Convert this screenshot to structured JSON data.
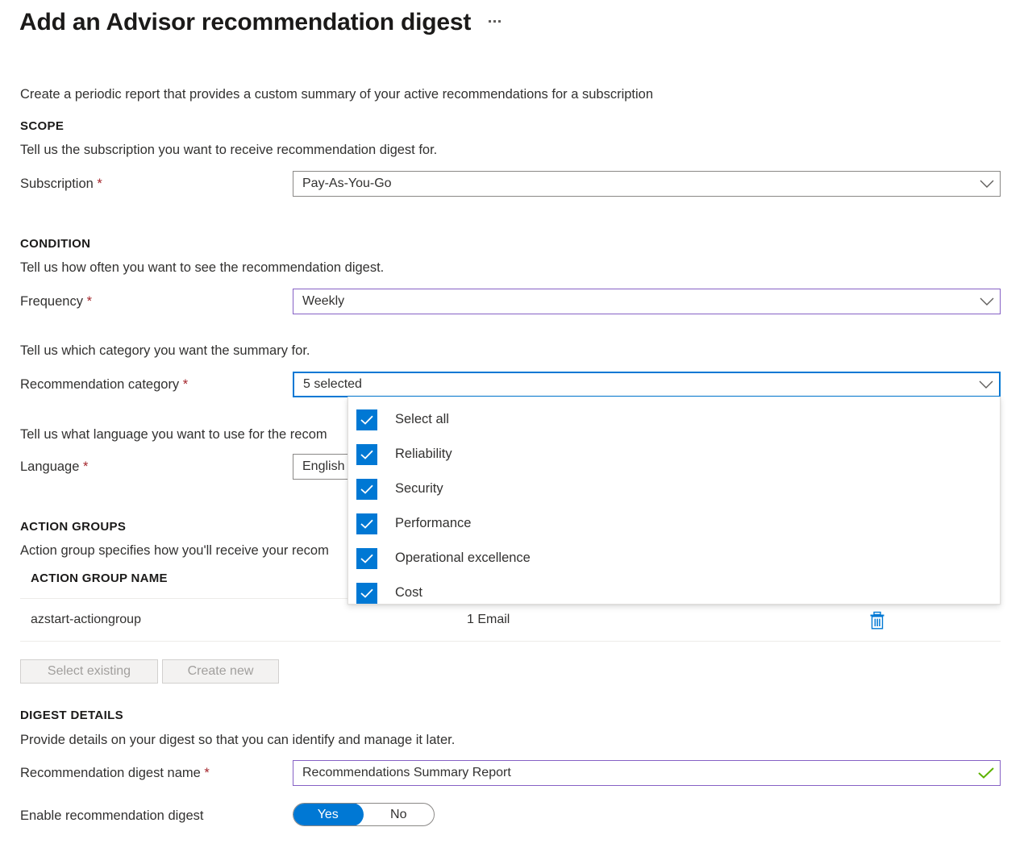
{
  "header": {
    "title": "Add an Advisor recommendation digest",
    "more_menu": "…"
  },
  "intro": "Create a periodic report that provides a custom summary of your active recommendations for a subscription",
  "scope": {
    "heading": "SCOPE",
    "description": "Tell us the subscription you want to receive recommendation digest for.",
    "subscription_label": "Subscription",
    "subscription_value": "Pay-As-You-Go",
    "required_mark": "*"
  },
  "condition": {
    "heading": "CONDITION",
    "description": "Tell us how often you want to see the recommendation digest.",
    "frequency_label": "Frequency",
    "frequency_value": "Weekly",
    "category_description": "Tell us which category you want the summary for.",
    "category_label": "Recommendation category",
    "category_value": "5 selected",
    "language_description": "Tell us what language you want to use for the recom",
    "language_label": "Language",
    "language_value": "English",
    "required_mark": "*"
  },
  "category_dropdown": {
    "options": [
      {
        "label": "Select all",
        "checked": true
      },
      {
        "label": "Reliability",
        "checked": true
      },
      {
        "label": "Security",
        "checked": true
      },
      {
        "label": "Performance",
        "checked": true
      },
      {
        "label": "Operational excellence",
        "checked": true
      },
      {
        "label": "Cost",
        "checked": true
      }
    ]
  },
  "action_groups": {
    "heading": "ACTION GROUPS",
    "description": "Action group specifies how you'll receive your recom",
    "column_name": "ACTION GROUP NAME",
    "rows": [
      {
        "name": "azstart-actiongroup",
        "detail": "1 Email"
      }
    ],
    "select_existing_label": "Select existing",
    "create_new_label": "Create new"
  },
  "digest_details": {
    "heading": "DIGEST DETAILS",
    "description": "Provide details on your digest so that you can identify and manage it later.",
    "name_label": "Recommendation digest name",
    "name_value": "Recommendations Summary Report",
    "enable_label": "Enable recommendation digest",
    "toggle_yes": "Yes",
    "toggle_no": "No",
    "toggle_state": "Yes",
    "required_mark": "*"
  },
  "colors": {
    "accent_blue": "#0078d4",
    "validated_purple": "#8661c5",
    "required_red": "#a4262c",
    "success_green": "#5db300"
  }
}
